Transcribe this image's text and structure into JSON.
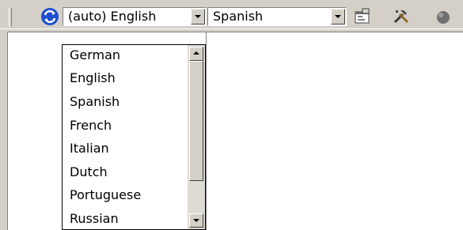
{
  "toolbar": {
    "source_language": "(auto) English",
    "target_language": "Spanish",
    "icons": [
      "swap-icon",
      "properties-icon",
      "tools-icon",
      "clear-icon"
    ]
  },
  "dropdown": {
    "items": [
      "German",
      "English",
      "Spanish",
      "French",
      "Italian",
      "Dutch",
      "Portuguese",
      "Russian"
    ],
    "scroll_position": 0
  },
  "colors": {
    "face": "#d4d0c8",
    "accent_blue": "#1d4fd1"
  }
}
